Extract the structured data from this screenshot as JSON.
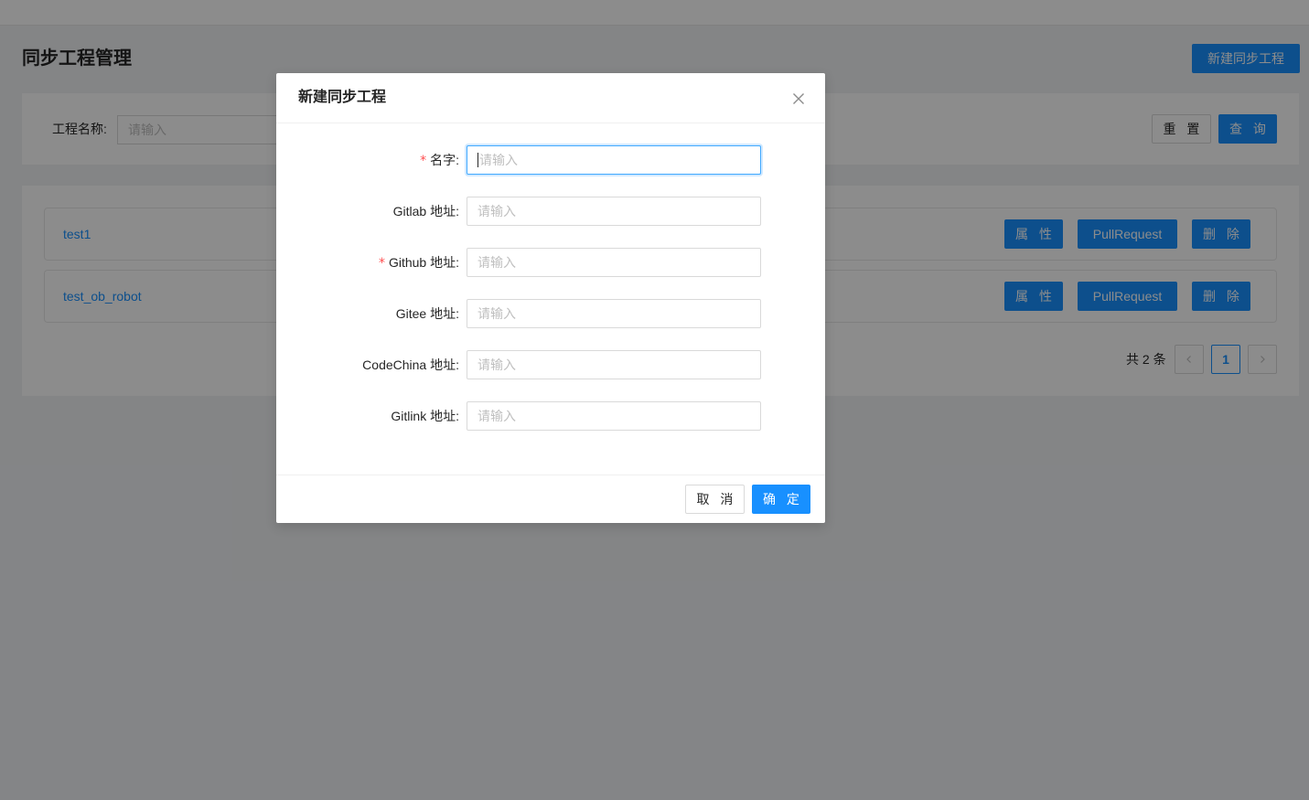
{
  "page": {
    "title": "同步工程管理",
    "new_button": "新建同步工程"
  },
  "search": {
    "label": "工程名称:",
    "placeholder": "请输入",
    "reset_label": "重 置",
    "query_label": "查 询"
  },
  "list": {
    "items": [
      {
        "name": "test1",
        "attr_label": "属 性",
        "pr_label": "PullRequest",
        "delete_label": "删 除"
      },
      {
        "name": "test_ob_robot",
        "attr_label": "属 性",
        "pr_label": "PullRequest",
        "delete_label": "删 除"
      }
    ]
  },
  "pagination": {
    "total": "共 2 条",
    "current_page": "1",
    "prev_icon": "chevron-left-icon",
    "next_icon": "chevron-right-icon"
  },
  "modal": {
    "title": "新建同步工程",
    "close_icon": "close-icon",
    "fields": [
      {
        "label": "名字:",
        "required": true,
        "placeholder": "请输入"
      },
      {
        "label": "Gitlab 地址:",
        "required": false,
        "placeholder": "请输入"
      },
      {
        "label": "Github 地址:",
        "required": true,
        "placeholder": "请输入"
      },
      {
        "label": "Gitee 地址:",
        "required": false,
        "placeholder": "请输入"
      },
      {
        "label": "CodeChina 地址:",
        "required": false,
        "placeholder": "请输入"
      },
      {
        "label": "Gitlink 地址:",
        "required": false,
        "placeholder": "请输入"
      }
    ],
    "required_mark": "*",
    "cancel_label": "取 消",
    "ok_label": "确 定"
  },
  "colors": {
    "primary": "#1890ff",
    "required": "#ff4d4f",
    "mask": "rgba(0,0,0,0.45)"
  }
}
